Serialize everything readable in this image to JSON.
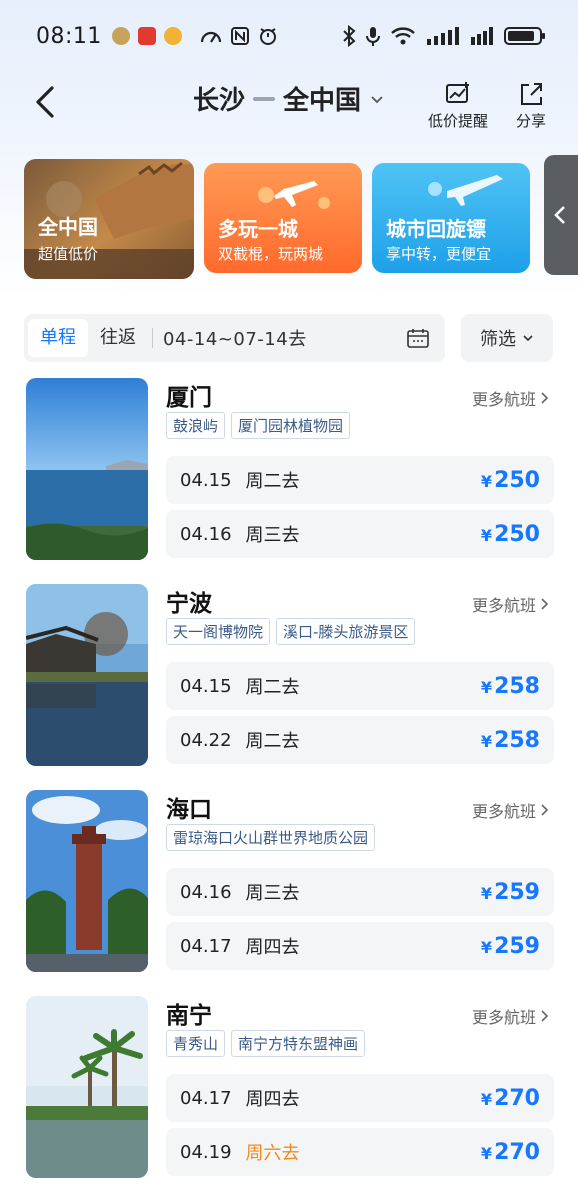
{
  "status_bar": {
    "time": "08:11"
  },
  "header": {
    "from_city": "长沙",
    "to_city": "全中国",
    "price_alert_label": "低价提醒",
    "share_label": "分享"
  },
  "banners": [
    {
      "title": "全中国",
      "subtitle": "超值低价"
    },
    {
      "title": "多玩一城",
      "subtitle": "双截棍，玩两城"
    },
    {
      "title": "城市回旋镖",
      "subtitle": "享中转，更便宜"
    }
  ],
  "trip_tabs": {
    "oneway": "单程",
    "roundtrip": "往返",
    "date_range": "04-14~07-14去"
  },
  "filter_label": "筛选",
  "destinations": [
    {
      "name": "厦门",
      "more": "更多航班",
      "tags": [
        "鼓浪屿",
        "厦门园林植物园"
      ],
      "flights": [
        {
          "date": "04.15",
          "weekday": "周二去",
          "price": "250",
          "weekend": false
        },
        {
          "date": "04.16",
          "weekday": "周三去",
          "price": "250",
          "weekend": false
        }
      ]
    },
    {
      "name": "宁波",
      "more": "更多航班",
      "tags": [
        "天一阁博物院",
        "溪口-滕头旅游景区"
      ],
      "flights": [
        {
          "date": "04.15",
          "weekday": "周二去",
          "price": "258",
          "weekend": false
        },
        {
          "date": "04.22",
          "weekday": "周二去",
          "price": "258",
          "weekend": false
        }
      ]
    },
    {
      "name": "海口",
      "more": "更多航班",
      "tags": [
        "雷琼海口火山群世界地质公园"
      ],
      "flights": [
        {
          "date": "04.16",
          "weekday": "周三去",
          "price": "259",
          "weekend": false
        },
        {
          "date": "04.17",
          "weekday": "周四去",
          "price": "259",
          "weekend": false
        }
      ]
    },
    {
      "name": "南宁",
      "more": "更多航班",
      "tags": [
        "青秀山",
        "南宁方特东盟神画"
      ],
      "flights": [
        {
          "date": "04.17",
          "weekday": "周四去",
          "price": "270",
          "weekend": false
        },
        {
          "date": "04.19",
          "weekday": "周六去",
          "price": "270",
          "weekend": true
        }
      ]
    }
  ],
  "currency_symbol": "¥",
  "colors": {
    "accent": "#1677ff",
    "weekend": "#f08a1c",
    "banner_orange": "#ff6a2c",
    "banner_blue": "#1ea0e8"
  }
}
